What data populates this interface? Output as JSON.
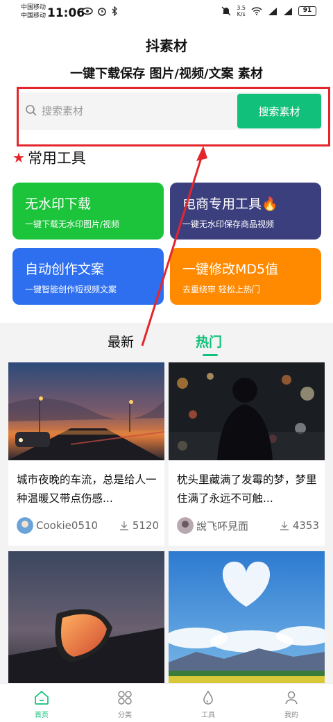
{
  "status_bar": {
    "carrier_1": "中国移动",
    "carrier_2": "中国移动",
    "time": "11:06",
    "net_speed": "3.5",
    "net_unit": "K/s",
    "battery": "91"
  },
  "header": {
    "title": "抖素材",
    "slogan": "一键下载保存 图片/视频/文案 素材"
  },
  "search": {
    "placeholder": "搜索素材",
    "button_label": "搜索素材"
  },
  "tools": {
    "heading": "常用工具",
    "items": [
      {
        "title": "无水印下载",
        "subtitle": "一键下载无水印图片/视频",
        "color": "#1bc43a"
      },
      {
        "title": "电商专用工具🔥",
        "subtitle": "一键无水印保存商品视频",
        "color": "#3c3f7e"
      },
      {
        "title": "自动创作文案",
        "subtitle": "一键智能创作短视频文案",
        "color": "#2e6ff0"
      },
      {
        "title": "一键修改MD5值",
        "subtitle": "去重绕审 轻松上热门",
        "color": "#ff8a00"
      }
    ]
  },
  "tabs": [
    {
      "label": "最新",
      "active": false
    },
    {
      "label": "热门",
      "active": true
    }
  ],
  "feed": [
    {
      "description": "城市夜晚的车流，总是给人一种温暖又带点伤感...",
      "author": "Cookie0510",
      "downloads": "5120"
    },
    {
      "description": "枕头里藏满了发霉的梦，梦里住满了永远不可触...",
      "author": "說飞吥見面",
      "downloads": "4353"
    },
    {
      "description": "",
      "author": "",
      "downloads": ""
    },
    {
      "description": "",
      "author": "",
      "downloads": ""
    }
  ],
  "bottom_nav": [
    {
      "label": "首页",
      "icon": "home-icon",
      "active": true
    },
    {
      "label": "分类",
      "icon": "grid-icon",
      "active": false
    },
    {
      "label": "工具",
      "icon": "drop-icon",
      "active": false
    },
    {
      "label": "我的",
      "icon": "user-icon",
      "active": false
    }
  ],
  "colors": {
    "accent": "#11c07a",
    "highlight_frame": "#e4262c"
  }
}
